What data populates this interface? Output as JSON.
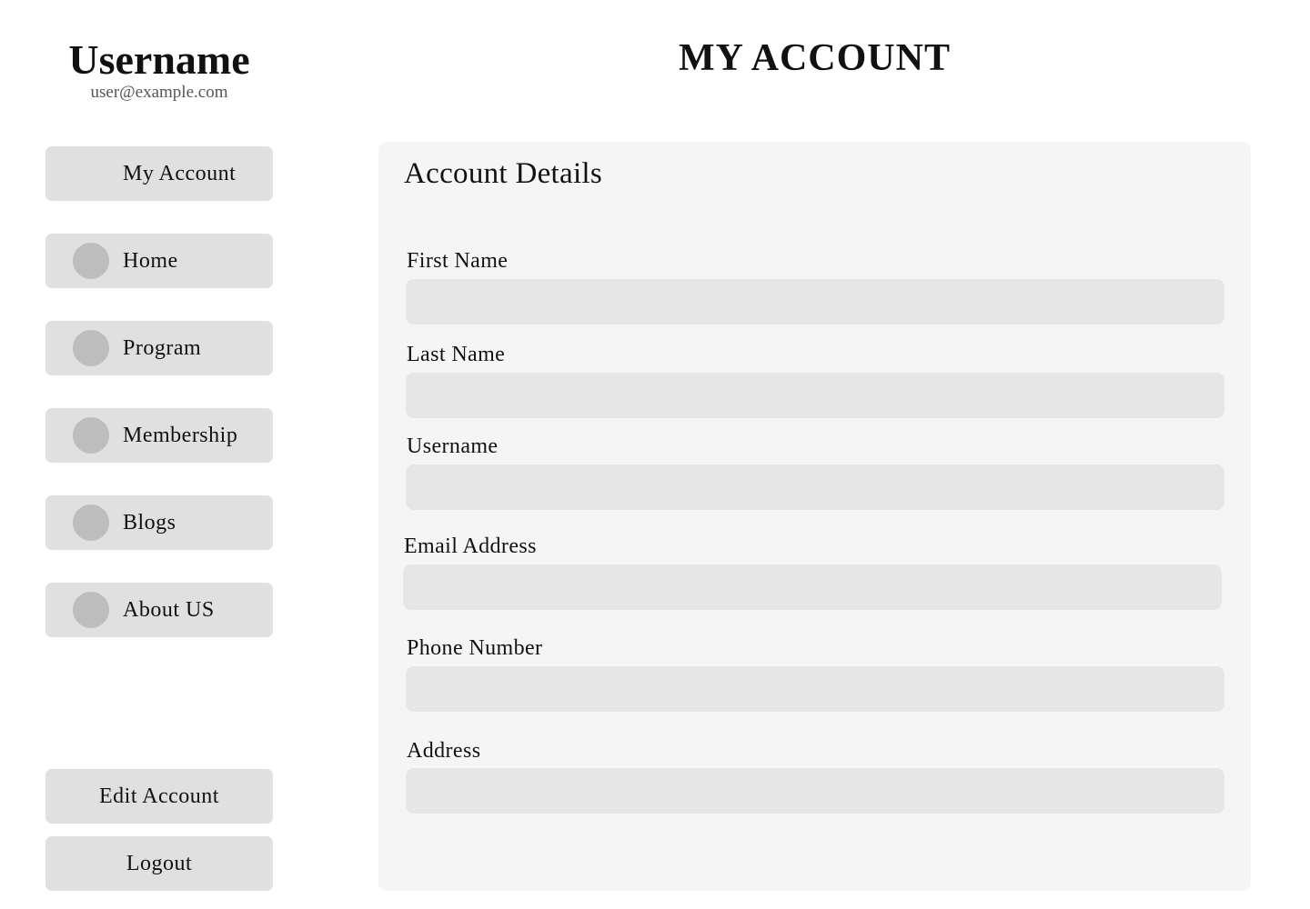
{
  "profile": {
    "name": "Username",
    "email": "user@example.com"
  },
  "sidebar": {
    "items": [
      {
        "label": "My Account",
        "icon": ""
      },
      {
        "label": "Home",
        "icon": "circle-icon"
      },
      {
        "label": "Program",
        "icon": "circle-icon"
      },
      {
        "label": "Membership",
        "icon": "circle-icon"
      },
      {
        "label": "Blogs",
        "icon": "circle-icon"
      },
      {
        "label": "About US",
        "icon": "circle-icon"
      }
    ],
    "edit_label": "Edit Account",
    "logout_label": "Logout"
  },
  "header": {
    "title": "MY ACCOUNT"
  },
  "account": {
    "title": "Account Details",
    "fields": [
      {
        "label": "First Name",
        "value": "",
        "placeholder": ""
      },
      {
        "label": "Last Name",
        "value": "",
        "placeholder": ""
      },
      {
        "label": "Username",
        "value": "",
        "placeholder": ""
      },
      {
        "label": "Email Address",
        "value": "",
        "placeholder": ""
      },
      {
        "label": "Phone Number",
        "value": "",
        "placeholder": ""
      },
      {
        "label": "Address",
        "value": "",
        "placeholder": ""
      }
    ]
  },
  "colors": {
    "button_bg": "#e0e0e0",
    "icon_dot": "#bdbdbd",
    "panel_bg": "#f5f5f5",
    "input_bg": "#e6e6e6"
  }
}
